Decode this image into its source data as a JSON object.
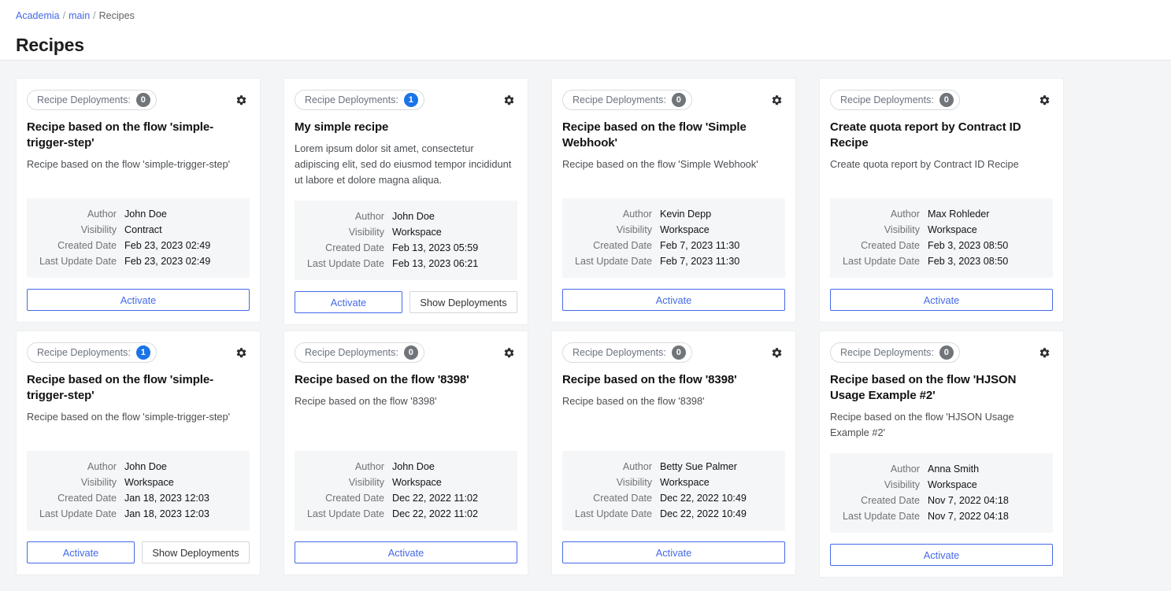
{
  "breadcrumb": {
    "items": [
      {
        "label": "Academia",
        "link": true
      },
      {
        "label": "main",
        "link": true
      },
      {
        "label": "Recipes",
        "link": false
      }
    ],
    "separator": "/"
  },
  "page": {
    "title": "Recipes"
  },
  "labels": {
    "deployments_badge": "Recipe Deployments:",
    "author": "Author",
    "visibility": "Visibility",
    "created_date": "Created Date",
    "last_update_date": "Last Update Date",
    "activate": "Activate",
    "show_deployments": "Show Deployments"
  },
  "colors": {
    "accent": "#4469e8",
    "badge_zero": "#70757a",
    "badge_active": "#1a73e8",
    "page_bg": "#f4f5f7",
    "card_bg": "#ffffff",
    "details_bg": "#f5f6f7"
  },
  "icons": {
    "gear": "gear-icon"
  },
  "cards": [
    {
      "deployments": "0",
      "deployments_state": "zero",
      "title": "Recipe based on the flow 'simple-trigger-step'",
      "description": "Recipe based on the flow 'simple-trigger-step'",
      "author": "John Doe",
      "visibility": "Contract",
      "created_date": "Feb 23, 2023 02:49",
      "last_update_date": "Feb 23, 2023 02:49",
      "has_show_deployments": false
    },
    {
      "deployments": "1",
      "deployments_state": "active",
      "title": "My simple recipe",
      "description": "Lorem ipsum dolor sit amet, consectetur adipiscing elit, sed do eiusmod tempor incididunt ut labore et dolore magna aliqua.",
      "author": "John Doe",
      "visibility": "Workspace",
      "created_date": "Feb 13, 2023 05:59",
      "last_update_date": "Feb 13, 2023 06:21",
      "has_show_deployments": true
    },
    {
      "deployments": "0",
      "deployments_state": "zero",
      "title": "Recipe based on the flow 'Simple Webhook'",
      "description": "Recipe based on the flow 'Simple Webhook'",
      "author": "Kevin Depp",
      "visibility": "Workspace",
      "created_date": "Feb 7, 2023 11:30",
      "last_update_date": "Feb 7, 2023 11:30",
      "has_show_deployments": false
    },
    {
      "deployments": "0",
      "deployments_state": "zero",
      "title": "Create quota report by Contract ID Recipe",
      "description": "Create quota report by Contract ID Recipe",
      "author": "Max Rohleder",
      "visibility": "Workspace",
      "created_date": "Feb 3, 2023 08:50",
      "last_update_date": "Feb 3, 2023 08:50",
      "has_show_deployments": false
    },
    {
      "deployments": "1",
      "deployments_state": "active",
      "title": "Recipe based on the flow 'simple-trigger-step'",
      "description": "Recipe based on the flow 'simple-trigger-step'",
      "author": "John Doe",
      "visibility": "Workspace",
      "created_date": "Jan 18, 2023 12:03",
      "last_update_date": "Jan 18, 2023 12:03",
      "has_show_deployments": true
    },
    {
      "deployments": "0",
      "deployments_state": "zero",
      "title": "Recipe based on the flow '8398'",
      "description": "Recipe based on the flow '8398'",
      "author": "John Doe",
      "visibility": "Workspace",
      "created_date": "Dec 22, 2022 11:02",
      "last_update_date": "Dec 22, 2022 11:02",
      "has_show_deployments": false
    },
    {
      "deployments": "0",
      "deployments_state": "zero",
      "title": "Recipe based on the flow '8398'",
      "description": "Recipe based on the flow '8398'",
      "author": "Betty Sue Palmer",
      "visibility": "Workspace",
      "created_date": "Dec 22, 2022 10:49",
      "last_update_date": "Dec 22, 2022 10:49",
      "has_show_deployments": false
    },
    {
      "deployments": "0",
      "deployments_state": "zero",
      "title": "Recipe based on the flow 'HJSON Usage Example #2'",
      "description": "Recipe based on the flow 'HJSON Usage Example #2'",
      "author": "Anna Smith",
      "visibility": "Workspace",
      "created_date": "Nov 7, 2022 04:18",
      "last_update_date": "Nov 7, 2022 04:18",
      "has_show_deployments": false
    }
  ]
}
